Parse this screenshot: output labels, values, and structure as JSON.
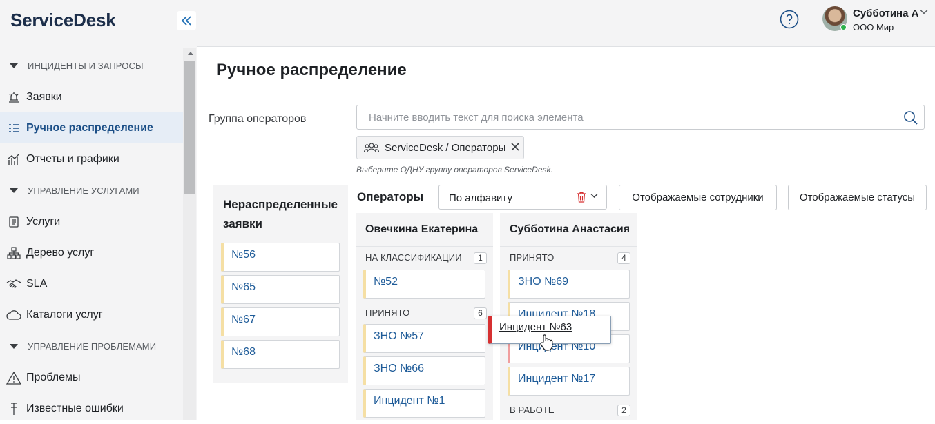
{
  "app": {
    "logo": "ServiceDesk"
  },
  "sidebar": {
    "sections": [
      {
        "title": "ИНЦИДЕНТЫ И ЗАПРОСЫ",
        "items": [
          {
            "label": "Заявки",
            "icon": "bell-icon",
            "active": false
          },
          {
            "label": "Ручное распределение",
            "icon": "list-distribute-icon",
            "active": true
          },
          {
            "label": "Отчеты и графики",
            "icon": "chart-icon",
            "active": false
          }
        ]
      },
      {
        "title": "УПРАВЛЕНИЕ УСЛУГАМИ",
        "items": [
          {
            "label": "Услуги",
            "icon": "services-icon",
            "active": false
          },
          {
            "label": "Дерево услуг",
            "icon": "tree-icon",
            "active": false
          },
          {
            "label": "SLA",
            "icon": "handshake-icon",
            "active": false
          },
          {
            "label": "Каталоги услуг",
            "icon": "cloud-icon",
            "active": false
          }
        ]
      },
      {
        "title": "УПРАВЛЕНИЕ ПРОБЛЕМАМИ",
        "items": [
          {
            "label": "Проблемы",
            "icon": "warning-icon",
            "active": false
          },
          {
            "label": "Известные ошибки",
            "icon": "pin-icon",
            "active": false
          }
        ]
      }
    ]
  },
  "header": {
    "user_name": "Субботина А",
    "user_org": "ООО Мир",
    "status_color": "#2ab14a"
  },
  "page": {
    "title": "Ручное распределение",
    "group_label": "Группа операторов",
    "search_placeholder": "Начните вводить текст для поиска элемента",
    "selected_group": "ServiceDesk / Операторы",
    "hint": "Выберите ОДНУ группу операторов ServiceDesk."
  },
  "unassigned": {
    "title": "Нераспределенные заявки",
    "tickets": [
      "№56",
      "№65",
      "№67",
      "№68"
    ]
  },
  "operators": {
    "title": "Операторы",
    "sort_value": "По алфавиту",
    "shown_employees_button": "Отображаемые сотрудники",
    "shown_statuses_button": "Отображаемые статусы",
    "columns": [
      {
        "name": "Овечкина Екатерина",
        "groups": [
          {
            "status": "НА КЛАССИФИКАЦИИ",
            "count": "1",
            "tickets": [
              "№52"
            ]
          },
          {
            "status": "ПРИНЯТО",
            "count": "6",
            "tickets": [
              "ЗНО №57",
              "ЗНО №66",
              "Инцидент №1"
            ]
          }
        ]
      },
      {
        "name": "Субботина Анастасия",
        "groups": [
          {
            "status": "ПРИНЯТО",
            "count": "4",
            "tickets": [
              "ЗНО №69",
              "Инцидент №18",
              "Инцидент №10",
              "Инцидент №17"
            ]
          },
          {
            "status": "В РАБОТЕ",
            "count": "2",
            "tickets": []
          }
        ]
      }
    ]
  },
  "drag_ghost": {
    "label": "Инцидент №63",
    "accent_color": "#d63031"
  },
  "colors": {
    "accent": "#1f5c99",
    "card_marker": "#f5dfa4",
    "card_marker_overdue": "#f09e9e"
  }
}
